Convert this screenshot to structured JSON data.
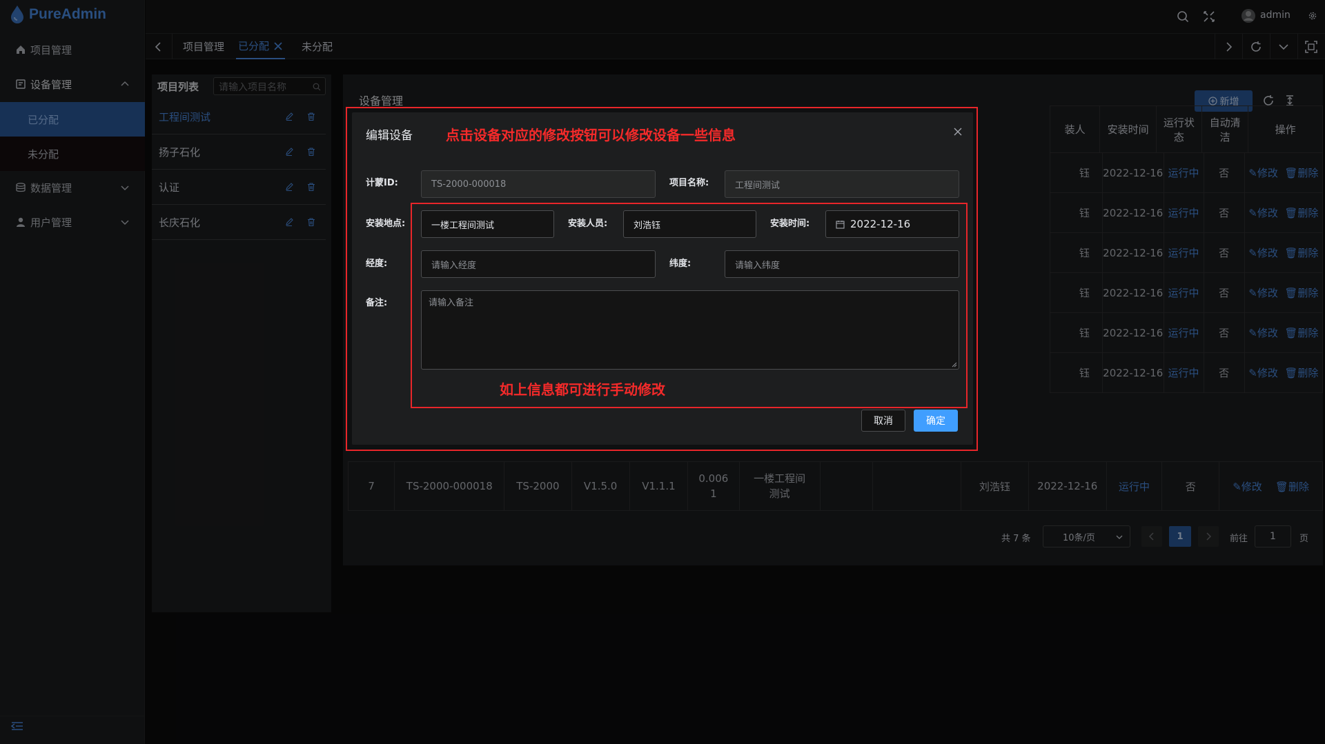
{
  "app": {
    "logo_text": "PureAdmin",
    "user_name": "admin"
  },
  "sidebar": {
    "items": [
      {
        "label": "项目管理",
        "icon": "home-icon"
      },
      {
        "label": "设备管理",
        "icon": "device-icon"
      },
      {
        "label": "已分配",
        "sub": true,
        "active": true
      },
      {
        "label": "未分配",
        "sub": true
      },
      {
        "label": "数据管理",
        "icon": "database-icon"
      },
      {
        "label": "用户管理",
        "icon": "user-icon"
      }
    ]
  },
  "tabs": [
    {
      "label": "项目管理"
    },
    {
      "label": "已分配",
      "active": true
    },
    {
      "label": "未分配"
    }
  ],
  "project_panel": {
    "title": "项目列表",
    "search_placeholder": "请输入项目名称",
    "projects": [
      {
        "name": "工程间测试",
        "active": true
      },
      {
        "name": "扬子石化"
      },
      {
        "name": "认证"
      },
      {
        "name": "长庆石化"
      }
    ]
  },
  "device_panel": {
    "title": "设备管理",
    "add_label": "新增",
    "headers": {
      "installer_partial": "装人",
      "install_time": "安装时间",
      "run_status": "运行状态",
      "auto_clean": "自动清洁",
      "actions": "操作"
    },
    "rows": [
      {
        "installer_partial": "钰",
        "install_time": "2022-12-16",
        "status": "运行中",
        "auto_clean": "否",
        "edit": "修改",
        "delete": "删除"
      },
      {
        "installer_partial": "钰",
        "install_time": "2022-12-16",
        "status": "运行中",
        "auto_clean": "否",
        "edit": "修改",
        "delete": "删除"
      },
      {
        "installer_partial": "钰",
        "install_time": "2022-12-16",
        "status": "运行中",
        "auto_clean": "否",
        "edit": "修改",
        "delete": "删除"
      },
      {
        "installer_partial": "钰",
        "install_time": "2022-12-16",
        "status": "运行中",
        "auto_clean": "否",
        "edit": "修改",
        "delete": "删除"
      },
      {
        "installer_partial": "钰",
        "install_time": "2022-12-16",
        "status": "运行中",
        "auto_clean": "否",
        "edit": "修改",
        "delete": "删除"
      },
      {
        "installer_partial": "钰",
        "install_time": "2022-12-16",
        "status": "运行中",
        "auto_clean": "否",
        "edit": "修改",
        "delete": "删除"
      }
    ],
    "row_peek": "测试",
    "last_row": {
      "index": "7",
      "meter_id": "TS-2000-000018",
      "model": "TS-2000",
      "hw": "V1.5.0",
      "sw": "V1.1.1",
      "value_line1": "0.006",
      "value_line2": "1",
      "location_line1": "一楼工程间",
      "location_line2": "测试",
      "installer": "刘浩钰",
      "install_time": "2022-12-16",
      "status": "运行中",
      "auto_clean": "否",
      "edit": "修改",
      "delete": "删除"
    },
    "pagination": {
      "total": "共 7 条",
      "page_size": "10条/页",
      "current_page": "1",
      "goto_label": "前往",
      "goto_value": "1",
      "page_suffix": "页"
    }
  },
  "dialog": {
    "title": "编辑设备",
    "annotation_top": "点击设备对应的修改按钮可以修改设备一些信息",
    "annotation_bottom": "如上信息都可进行手动修改",
    "fields": {
      "meter_id_label": "计蒙ID:",
      "meter_id_value": "TS-2000-000018",
      "project_label": "项目名称:",
      "project_value": "工程间测试",
      "location_label": "安装地点:",
      "location_value": "一楼工程间测试",
      "installer_label": "安装人员:",
      "installer_value": "刘浩钰",
      "time_label": "安装时间:",
      "time_value": "2022-12-16",
      "lng_label": "经度:",
      "lng_placeholder": "请输入经度",
      "lat_label": "纬度:",
      "lat_placeholder": "请输入纬度",
      "note_label": "备注:",
      "note_placeholder": "请输入备注"
    },
    "cancel_label": "取消",
    "confirm_label": "确定"
  },
  "colors": {
    "accent": "#409eff",
    "annotation": "#f52a2a",
    "sidebar_active": "#2b5a9c"
  }
}
